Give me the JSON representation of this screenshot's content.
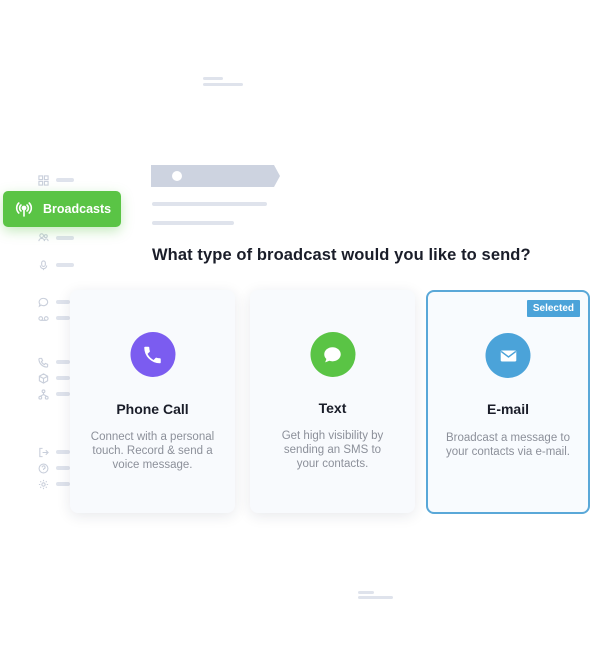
{
  "sidebar": {
    "active_item": {
      "label": "Broadcasts",
      "icon": "broadcast-icon"
    },
    "icons": [
      "grid-icon",
      "users-icon",
      "mic-icon",
      "chat-icon",
      "voicemail-icon",
      "phone-icon",
      "box-icon",
      "network-icon",
      "logout-icon",
      "help-icon",
      "settings-icon"
    ]
  },
  "main": {
    "question": "What type of broadcast would you like to send?",
    "options": [
      {
        "title": "Phone Call",
        "description": "Connect with a personal touch. Record & send a voice message.",
        "icon": "phone-icon",
        "color": "#7b5cf0",
        "selected": false
      },
      {
        "title": "Text",
        "description": "Get high visibility by sending an SMS to your contacts.",
        "icon": "chat-bubble-icon",
        "color": "#5ac445",
        "selected": false
      },
      {
        "title": "E-mail",
        "description": "Broadcast a message to your contacts via e-mail.",
        "icon": "envelope-icon",
        "color": "#4ba3d9",
        "selected": true,
        "badge": "Selected"
      }
    ]
  },
  "colors": {
    "accent_green": "#5ac445",
    "accent_blue": "#4ba3d9",
    "accent_purple": "#7b5cf0"
  }
}
